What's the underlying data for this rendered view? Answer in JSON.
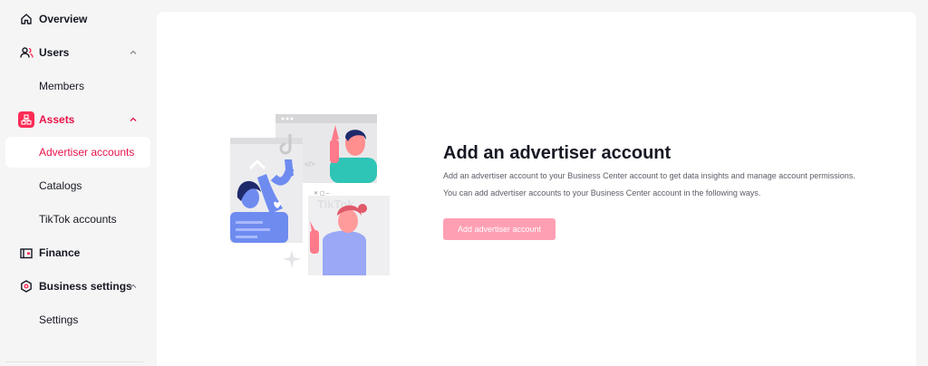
{
  "sidebar": {
    "items": [
      {
        "label": "Overview",
        "icon": "home-icon"
      },
      {
        "label": "Users",
        "icon": "users-icon"
      },
      {
        "label": "Members"
      },
      {
        "label": "Assets",
        "icon": "assets-icon"
      },
      {
        "label": "Advertiser accounts"
      },
      {
        "label": "Catalogs"
      },
      {
        "label": "TikTok accounts"
      },
      {
        "label": "Finance",
        "icon": "wallet-icon"
      },
      {
        "label": "Business settings",
        "icon": "settings-icon"
      },
      {
        "label": "Settings"
      }
    ]
  },
  "main": {
    "title": "Add an advertiser account",
    "desc_line1": "Add an advertiser account to your Business Center account to get data insights and manage account permissions.",
    "desc_line2": "You can add advertiser accounts to your Business Center account in the following ways.",
    "add_button": "Add advertiser account",
    "illustration_text": "TikTok"
  },
  "colors": {
    "accent": "#e6144a",
    "button_disabled": "#ff9fb3",
    "illustration_blue": "#6e8bf0",
    "illustration_teal": "#2ec4b6",
    "illustration_pink": "#ff7a8a"
  }
}
